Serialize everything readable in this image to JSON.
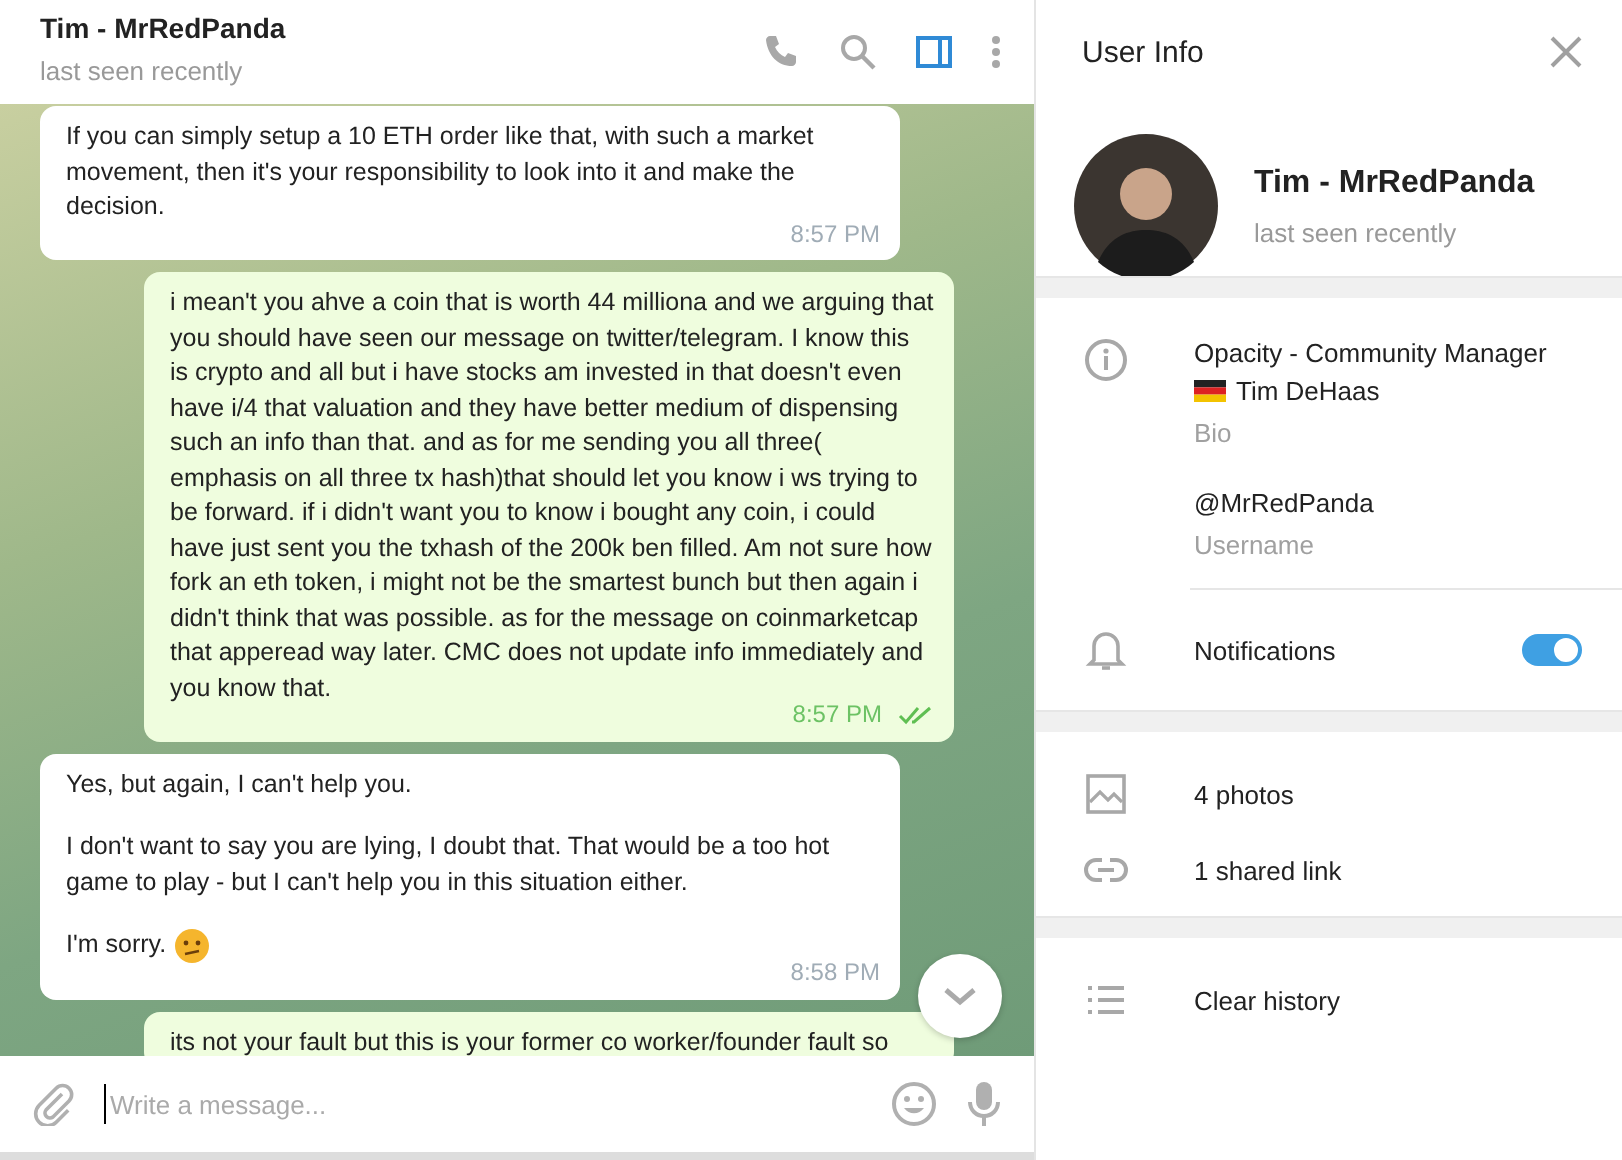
{
  "chat_header": {
    "name": "Tim - MrRedPanda",
    "status": "last seen recently",
    "info_panel_open": true
  },
  "messages": [
    {
      "kind": "in",
      "paragraphs": [
        "If you can simply setup a 10 ETH order like that, with such a market movement, then it's your responsibility to look into it and make the decision."
      ],
      "time": "8:57 PM"
    },
    {
      "kind": "out",
      "paragraphs": [
        "i mean't you ahve a coin that is worth 44 milliona and we arguing that you should have seen our message on twitter/telegram. I know this is crypto and all but i have stocks am invested in that doesn't even have i/4 that valuation and they have better medium of dispensing such an info than that. and as for me sending you all three( emphasis on all three tx hash)that should let you know i ws trying to be forward. if i didn't want you to know i bought any coin, i could have just sent you the txhash of the 200k ben filled.  Am not sure how fork an eth token, i might not be the smartest bunch but then again i didn't think that was possible. as for the message on coinmarketcap that apperead way later. CMC does not update info immediately and you know that."
      ],
      "time": "8:57 PM",
      "read": true
    },
    {
      "kind": "in",
      "paragraphs": [
        "Yes, but again, I can't help you.",
        "I don't want to say you are lying, I doubt that. That would be a too hot game to play - but I can't help you in this situation either.",
        "I'm sorry."
      ],
      "time": "8:58 PM",
      "emoji": true
    },
    {
      "kind": "out",
      "paragraphs": [
        "its not your fault but this is your former co worker/founder fault so"
      ]
    }
  ],
  "composer": {
    "placeholder": "Write a message..."
  },
  "user_info": {
    "title": "User Info",
    "name": "Tim - MrRedPanda",
    "status": "last seen recently",
    "bio": {
      "title": "Opacity - Community Manager",
      "flag": true,
      "name": "Tim DeHaas",
      "label": "Bio"
    },
    "username": {
      "value": "@MrRedPanda",
      "label": "Username"
    },
    "notifications": {
      "label": "Notifications",
      "on": true
    },
    "media": [
      {
        "kind": "photos",
        "label": "4 photos"
      },
      {
        "kind": "link",
        "label": "1 shared link"
      }
    ],
    "actions": [
      {
        "kind": "list",
        "label": "Clear history"
      }
    ]
  }
}
